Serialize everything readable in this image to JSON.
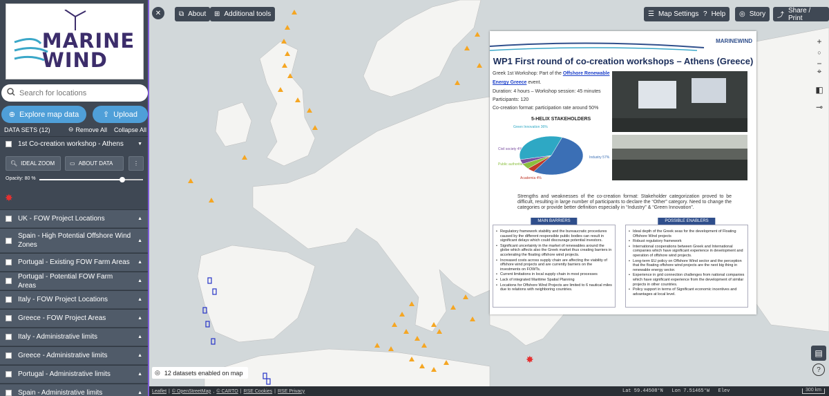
{
  "logo": {
    "line1": "MARINE",
    "line2": "WIND"
  },
  "search": {
    "placeholder": "Search for locations"
  },
  "buttons": {
    "explore": "Explore map data",
    "upload": "Upload"
  },
  "datasets": {
    "heading": "DATA SETS (12)",
    "remove_all": "Remove All",
    "collapse_all": "Collapse All",
    "active": {
      "name": "1st Co-creation workshop - Athens",
      "ideal_zoom": "IDEAL ZOOM",
      "about_data": "ABOUT DATA",
      "opacity_label": "Opacity: 80 %",
      "opacity": 0.8
    },
    "items": [
      {
        "name": "UK - FOW Project Locations"
      },
      {
        "name": "Spain - High Potential Offshore Wind Zones"
      },
      {
        "name": "Portugal - Existing FOW Farm Areas"
      },
      {
        "name": "Portugal - Potential FOW Farm Areas"
      },
      {
        "name": "Italy - FOW Project Locations"
      },
      {
        "name": "Greece - FOW Project Areas"
      },
      {
        "name": "Italy - Administrative limits"
      },
      {
        "name": "Greece - Administrative limits"
      },
      {
        "name": "Portugal - Administrative limits"
      },
      {
        "name": "Spain - Administrative limits"
      }
    ]
  },
  "toolbar": {
    "about": "About",
    "additional_tools": "Additional tools",
    "map_settings": "Map Settings",
    "help": "Help",
    "story": "Story",
    "share": "Share / Print"
  },
  "panel": {
    "brand": "MARINEWIND",
    "title": "WP1 First round of co-creation workshops – Athens (Greece)",
    "line1a": "Greek 1st Workshop: Part of the ",
    "line1b": "Offshore Renewable",
    "line2a": "Energy Greece",
    "line2b": " event.",
    "duration": "Duration: 4 hours – Workshop session: 45 minutes",
    "participants": "Participants: 120",
    "format": "Co-creation format: participation rate around 50%",
    "chart_title": "5-HELIX STAKEHOLDERS",
    "strengths": "Strengths and weaknesses of the co-creation format: Stakeholder categorization proved to be difficult, resulting in large number of participants to declare the “Other” category. Need to change the categories or provide better definition especially in “Industry” & “Green Innovation”.",
    "barriers_title": "MAIN BARRIERS",
    "barriers": [
      "Regulatory framework stability and the bureaucratic procedures caused by the different responsible public bodies can result in significant delays which could discourage potential investors.",
      "Significant uncertainty in the market of renewables around the globe which affects also the Greek market thus creating barriers in accelerating the floating offshore wind projects.",
      "Increased costs across supply chain are affecting the viability of offshore wind projects and are currently barriers on the investments on FOWTs.",
      "Current limitations in local supply chain in most processes",
      "Lack of integrated Maritime Spatial Planning",
      "Locations for Offshore Wind Projects are limited to 6 nautical miles due to relations with neighboring countries."
    ],
    "enablers_title": "POSSIBLE ENABLERS",
    "enablers": [
      "Ideal depth of the Greek seas for the development of Floating Offshore Wind projects",
      "Robust regulatory framework",
      "International cooperations between Greek and International companies which have significant experience in development and operation of offshore wind projects.",
      "Long-term EU policy on Offshore Wind sector and the perception that the floating offshore wind projects are the next big thing in renewable energy sector.",
      "Experience in grid connection challenges from national companies which have significant experience from the development of similar projects in other countries.",
      "Policy support in terms of Significant economic incentives and advantages at local level."
    ]
  },
  "chart_data": {
    "type": "pie",
    "title": "5-HELIX STAKEHOLDERS",
    "categories": [
      "Industry",
      "Academia",
      "Public authorities",
      "Civil society",
      "Green Innovation"
    ],
    "values": [
      57,
      4,
      5,
      4,
      36
    ],
    "labels": [
      "Industry 57%",
      "Academia 4%",
      "Public authorities 5%",
      "Civil society 4%",
      "Green Innovation 36%"
    ],
    "colors": [
      "#3b6fb5",
      "#c0392b",
      "#8bbf3f",
      "#7a4fa0",
      "#2ea8c4"
    ]
  },
  "status": {
    "datasets_enabled": "12 datasets enabled on map"
  },
  "attribution": {
    "leaflet": "Leaflet",
    "osm": "© OpenStreetMap",
    "carto": "© CARTO",
    "cookies": "RSE Cookies",
    "privacy": "RSE Privacy",
    "lat": "Lat  59.44508°N",
    "lon": "Lon  7.51465°W",
    "elev": "Elev",
    "scale": "300 km"
  }
}
